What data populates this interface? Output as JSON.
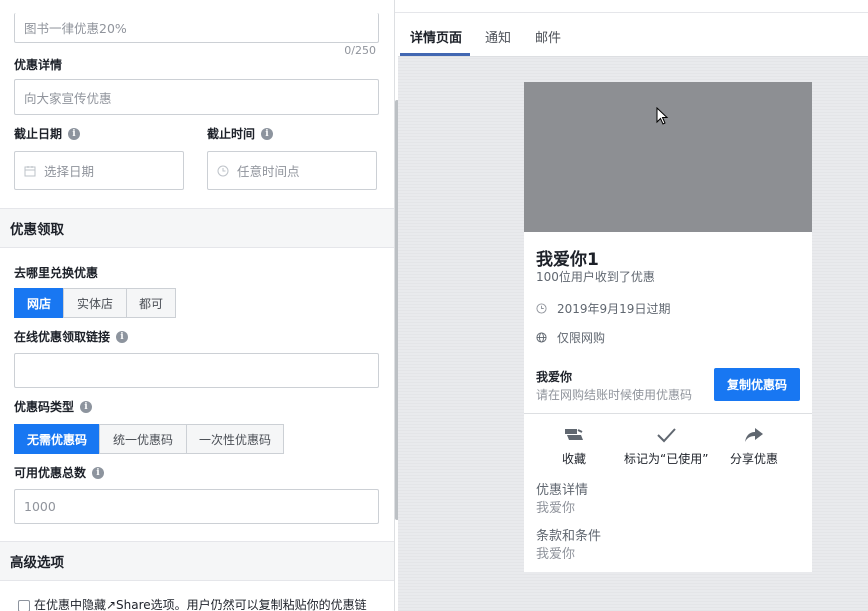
{
  "form": {
    "title_value": "图书一律优惠20%",
    "title_counter": "0/250",
    "details_label": "优惠详情",
    "details_placeholder": "向大家宣传优惠",
    "end_date_label": "截止日期",
    "end_time_label": "截止时间",
    "date_placeholder": "选择日期",
    "time_placeholder": "任意时间点"
  },
  "redeem_section": {
    "title": "优惠领取",
    "where_label": "去哪里兑换优惠",
    "where_options": [
      "网店",
      "实体店",
      "都可"
    ],
    "where_selected": "网店",
    "link_label": "在线优惠领取链接",
    "code_type_label": "优惠码类型",
    "code_type_options": [
      "无需优惠码",
      "统一优惠码",
      "一次性优惠码"
    ],
    "code_type_selected": "无需优惠码",
    "total_label": "可用优惠总数",
    "total_placeholder": "1000"
  },
  "advanced_section": {
    "title": "高级选项",
    "hide_share_text": "在优惠中隐藏↗Share选项。用户仍然可以复制粘贴你的优惠链"
  },
  "preview_tabs": [
    "详情页面",
    "通知",
    "邮件"
  ],
  "preview_active_tab": "详情页面",
  "card": {
    "title": "我爱你1",
    "subtitle": "100位用户收到了优惠",
    "expiry": "2019年9月19日过期",
    "scope": "仅限网购",
    "code_title": "我爱你",
    "code_hint": "请在网购结账时候使用优惠码",
    "copy_button": "复制优惠码",
    "actions": [
      "收藏",
      "标记为“已使用”",
      "分享优惠"
    ],
    "details_heading": "优惠详情",
    "details_value": "我爱你",
    "terms_heading": "条款和条件",
    "terms_value": "我爱你"
  },
  "colors": {
    "accent": "#1877f2",
    "cover": "#8d8f93"
  }
}
